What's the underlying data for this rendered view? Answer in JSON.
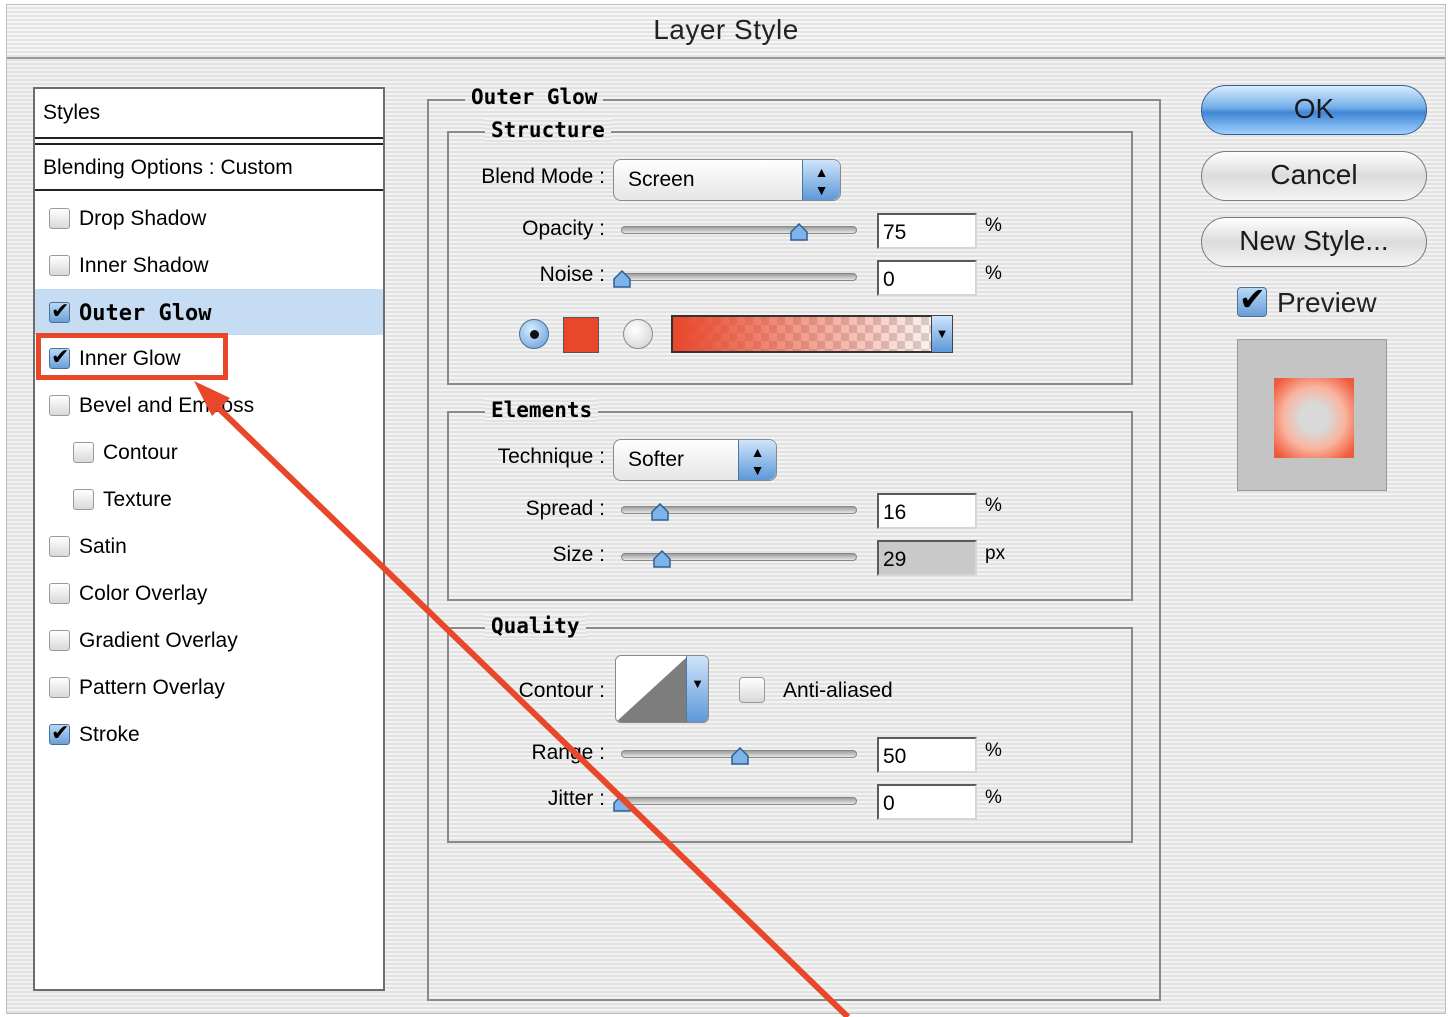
{
  "window": {
    "title": "Layer Style"
  },
  "styles_panel": {
    "header": "Styles",
    "blending": "Blending Options : Custom",
    "items": [
      {
        "label": "Drop Shadow",
        "checked": false,
        "selected": false,
        "indent": false
      },
      {
        "label": "Inner  Shadow",
        "checked": false,
        "selected": false,
        "indent": false
      },
      {
        "label": "Outer Glow",
        "checked": true,
        "selected": true,
        "indent": false
      },
      {
        "label": "Inner Glow",
        "checked": true,
        "selected": false,
        "indent": false
      },
      {
        "label": "Bevel and Emboss",
        "checked": false,
        "selected": false,
        "indent": false
      },
      {
        "label": "Contour",
        "checked": false,
        "selected": false,
        "indent": true
      },
      {
        "label": "Texture",
        "checked": false,
        "selected": false,
        "indent": true
      },
      {
        "label": "Satin",
        "checked": false,
        "selected": false,
        "indent": false
      },
      {
        "label": "Color Overlay",
        "checked": false,
        "selected": false,
        "indent": false
      },
      {
        "label": "Gradient  Overlay",
        "checked": false,
        "selected": false,
        "indent": false
      },
      {
        "label": "Pattern  Overlay",
        "checked": false,
        "selected": false,
        "indent": false
      },
      {
        "label": "Stroke",
        "checked": true,
        "selected": false,
        "indent": false
      }
    ]
  },
  "outer_glow": {
    "title": "Outer Glow",
    "structure": {
      "title": "Structure",
      "blend_mode_label": "Blend Mode :",
      "blend_mode": "Screen",
      "opacity_label": "Opacity :",
      "opacity": "75",
      "opacity_unit": "%",
      "opacity_level": 0.75,
      "noise_label": "Noise :",
      "noise": "0",
      "noise_unit": "%",
      "noise_level": 0.0,
      "color_mode": "solid",
      "glow_color": "#e8472a"
    },
    "elements": {
      "title": "Elements",
      "technique_label": "Technique :",
      "technique": "Softer",
      "spread_label": "Spread :",
      "spread": "16",
      "spread_unit": "%",
      "spread_level": 0.16,
      "size_label": "Size :",
      "size": "29",
      "size_unit": "px",
      "size_level": 0.17
    },
    "quality": {
      "title": "Quality",
      "contour_label": "Contour :",
      "anti_aliased_label": "Anti-aliased",
      "anti_aliased": false,
      "range_label": "Range :",
      "range": "50",
      "range_unit": "%",
      "range_level": 0.5,
      "jitter_label": "Jitter :",
      "jitter": "0",
      "jitter_unit": "%",
      "jitter_level": 0.0
    }
  },
  "actions": {
    "ok": "OK",
    "cancel": "Cancel",
    "new_style": "New Style...",
    "preview_label": "Preview",
    "preview_checked": true
  },
  "colors": {
    "annotation": "#e8472a",
    "selection": "#c6dcf2",
    "aqua_blue": "#3f86d4"
  }
}
